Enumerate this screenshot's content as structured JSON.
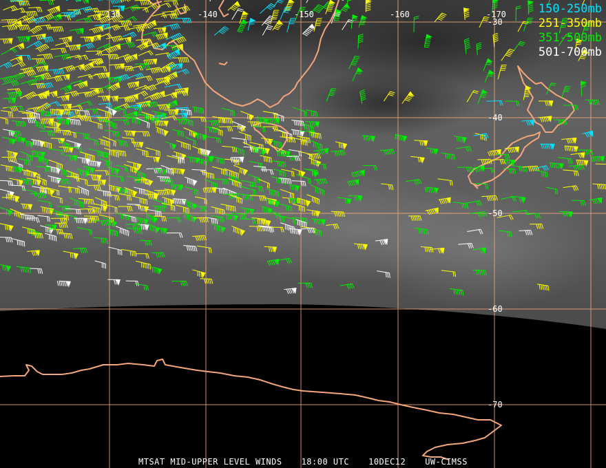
{
  "title": {
    "product": "MTSAT MID-UPPER LEVEL WINDS",
    "time": "18:00 UTC",
    "date": "10DEC12",
    "credit": "UW-CIMSS"
  },
  "longitude_labels": [
    "-130",
    "-140",
    "-150",
    "-160",
    "-170"
  ],
  "latitude_labels": [
    "-30",
    "-40",
    "-50",
    "-60",
    "-70"
  ],
  "legend": [
    {
      "label": "150-250mb",
      "color": "#00e5ff"
    },
    {
      "label": "251-350mb",
      "color": "#ffff00"
    },
    {
      "label": "351-500mb",
      "color": "#00ee00"
    },
    {
      "label": "501-700mb",
      "color": "#ffffff"
    }
  ],
  "colors": {
    "coastline": "#f4a67c",
    "gridline": "#f4a67c",
    "image_area": "#555555",
    "no_data": "#000000"
  }
}
